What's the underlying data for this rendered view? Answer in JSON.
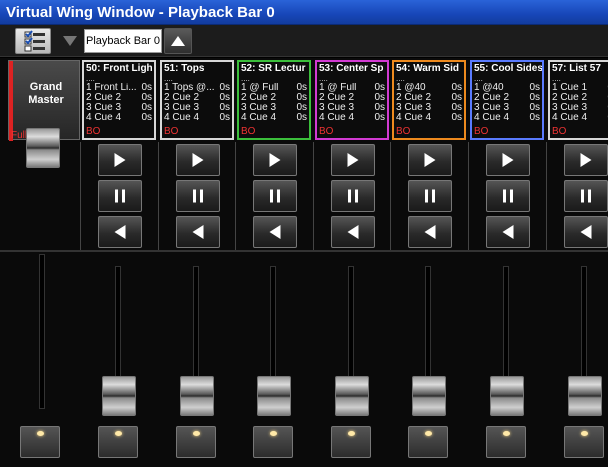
{
  "window": {
    "title": "Virtual Wing Window - Playback Bar 0"
  },
  "toolbar": {
    "playback_bar_label": "Playback Bar 0"
  },
  "grand_master": {
    "label": "Grand Master",
    "level": "Full",
    "level_fraction": 1.0
  },
  "cuelists": [
    {
      "title": "50: Front Ligh",
      "border": "#d8d8d8",
      "status": "BO",
      "fader": 0.0,
      "cues": [
        [
          "1 Front Li...",
          "0s"
        ],
        [
          "2 Cue 2",
          "0s"
        ],
        [
          "3 Cue 3",
          "0s"
        ],
        [
          "4 Cue 4",
          "0s"
        ]
      ]
    },
    {
      "title": "51: Tops",
      "border": "#d8d8d8",
      "status": "BO",
      "fader": 0.0,
      "cues": [
        [
          "1 Tops @...",
          "0s"
        ],
        [
          "2 Cue 2",
          "0s"
        ],
        [
          "3 Cue 3",
          "0s"
        ],
        [
          "4 Cue 4",
          "0s"
        ]
      ]
    },
    {
      "title": "52: SR Lectur",
      "border": "#3bbf3b",
      "status": "BO",
      "fader": 0.0,
      "cues": [
        [
          "1 @ Full",
          "0s"
        ],
        [
          "2 Cue 2",
          "0s"
        ],
        [
          "3 Cue 3",
          "0s"
        ],
        [
          "4 Cue 4",
          "0s"
        ]
      ]
    },
    {
      "title": "53: Center Sp",
      "border": "#d23ad2",
      "status": "BO",
      "fader": 0.0,
      "cues": [
        [
          "1 @ Full",
          "0s"
        ],
        [
          "2 Cue 2",
          "0s"
        ],
        [
          "3 Cue 3",
          "0s"
        ],
        [
          "4 Cue 4",
          "0s"
        ]
      ]
    },
    {
      "title": "54: Warm Sid",
      "border": "#ee8a1e",
      "status": "BO",
      "fader": 0.0,
      "cues": [
        [
          "1 @40",
          "0s"
        ],
        [
          "2 Cue 2",
          "0s"
        ],
        [
          "3 Cue 3",
          "0s"
        ],
        [
          "4 Cue 4",
          "0s"
        ]
      ]
    },
    {
      "title": "55: Cool Sides",
      "border": "#5a7bff",
      "status": "BO",
      "fader": 0.0,
      "cues": [
        [
          "1 @40",
          "0s"
        ],
        [
          "2 Cue 2",
          "0s"
        ],
        [
          "3 Cue 3",
          "0s"
        ],
        [
          "4 Cue 4",
          "0s"
        ]
      ]
    },
    {
      "title": "57: List 57",
      "border": "#d8d8d8",
      "status": "BO",
      "fader": 0.0,
      "cues": [
        [
          "1 Cue 1",
          "0s"
        ],
        [
          "2 Cue 2",
          "0s"
        ],
        [
          "3 Cue 3",
          "0s"
        ],
        [
          "4 Cue 4",
          "0s"
        ]
      ]
    }
  ],
  "icons": {
    "list": "checklist-icon",
    "down": "arrow-down-icon",
    "up": "arrow-up-icon",
    "go": "play-icon",
    "pause": "pause-icon",
    "back": "back-icon"
  }
}
